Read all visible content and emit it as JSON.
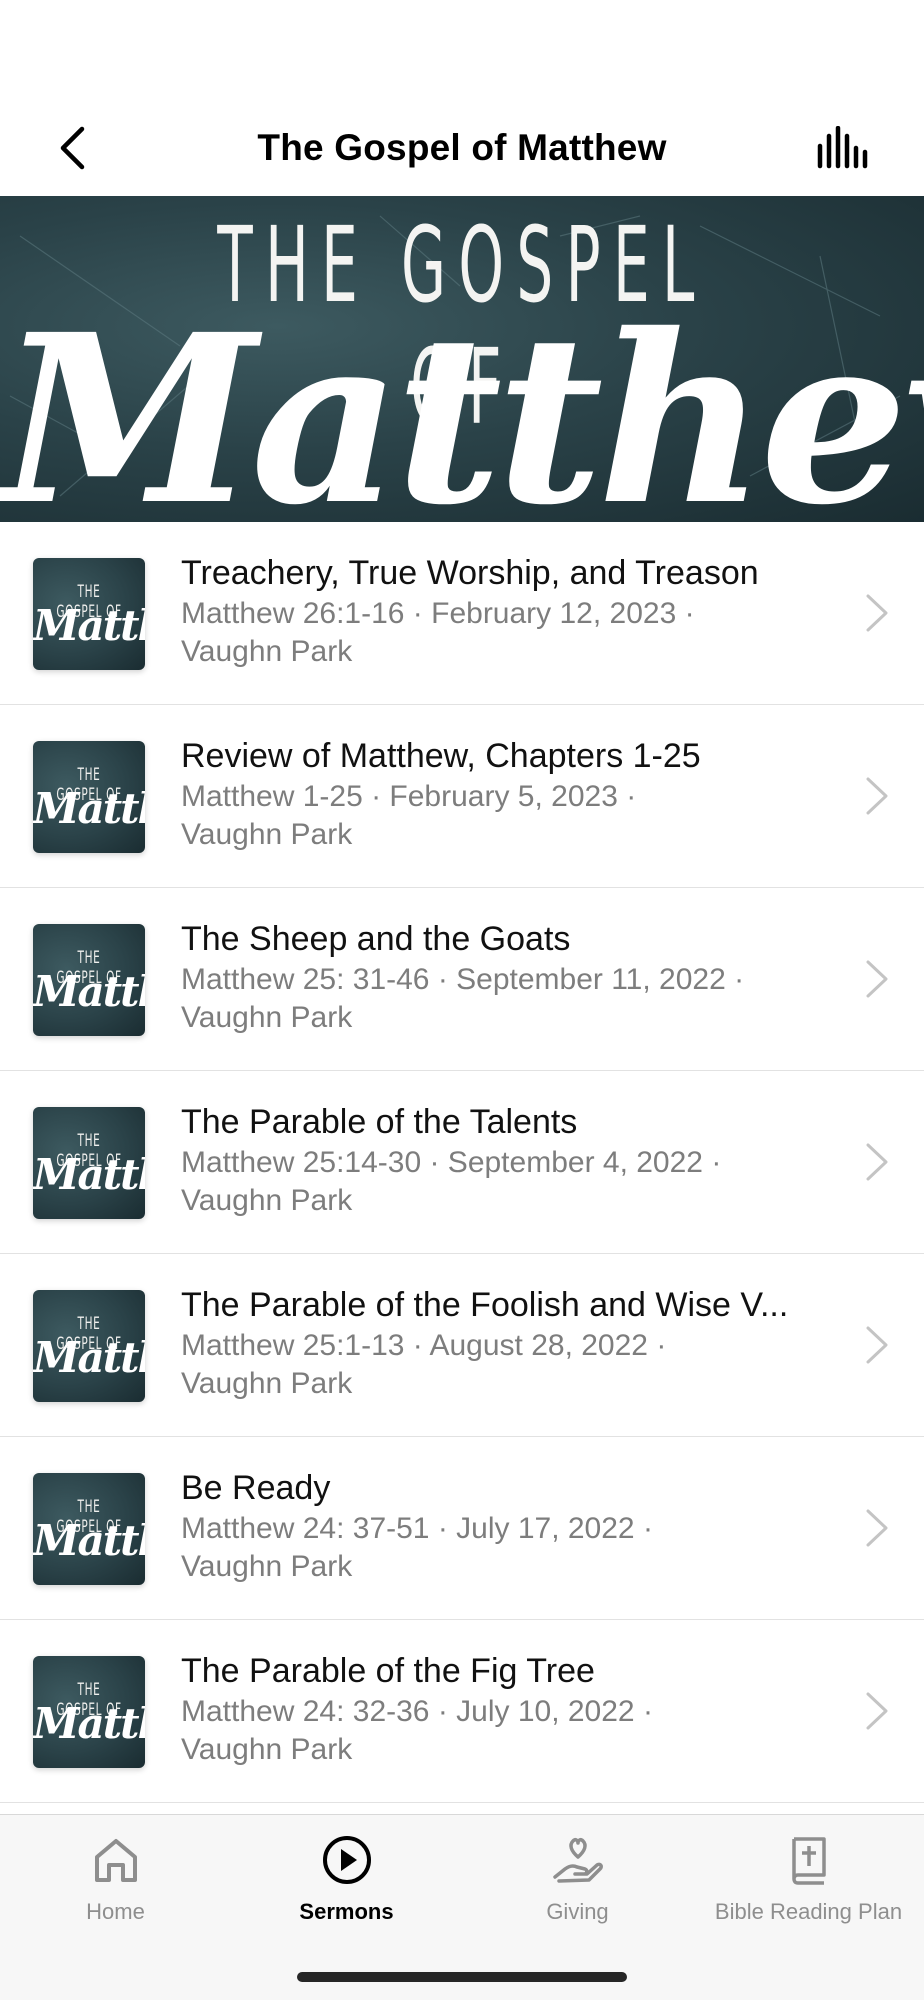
{
  "header": {
    "title": "The Gospel of Matthew",
    "back_icon": "chevron-left-icon",
    "audio_icon": "audio-levels-icon"
  },
  "banner": {
    "line1": "THE GOSPEL OF",
    "line2": "Matthew"
  },
  "thumbnail": {
    "line1": "THE GOSPEL OF",
    "line2": "Matthew"
  },
  "sermons": [
    {
      "title": "Treachery, True Worship, and Treason",
      "subtitle_line1": "Matthew 26:1-16 · February 12, 2023 ·",
      "subtitle_line2": "Vaughn Park"
    },
    {
      "title": "Review of Matthew, Chapters 1-25",
      "subtitle_line1": "Matthew 1-25 · February 5, 2023 ·",
      "subtitle_line2": "Vaughn Park"
    },
    {
      "title": "The Sheep and the Goats",
      "subtitle_line1": "Matthew 25: 31-46 · September 11, 2022 ·",
      "subtitle_line2": "Vaughn Park"
    },
    {
      "title": "The Parable of the Talents",
      "subtitle_line1": "Matthew 25:14-30 · September 4, 2022 ·",
      "subtitle_line2": "Vaughn Park"
    },
    {
      "title": "The Parable of the Foolish and Wise V...",
      "subtitle_line1": "Matthew 25:1-13 · August 28, 2022 ·",
      "subtitle_line2": "Vaughn Park"
    },
    {
      "title": "Be Ready",
      "subtitle_line1": "Matthew 24: 37-51 · July 17, 2022 ·",
      "subtitle_line2": "Vaughn Park"
    },
    {
      "title": "The Parable of the Fig Tree",
      "subtitle_line1": "Matthew 24: 32-36 · July 10, 2022 ·",
      "subtitle_line2": "Vaughn Park"
    }
  ],
  "tabs": [
    {
      "label": "Home",
      "icon": "home-icon",
      "active": false
    },
    {
      "label": "Sermons",
      "icon": "play-circle-icon",
      "active": true
    },
    {
      "label": "Giving",
      "icon": "heart-hand-icon",
      "active": false
    },
    {
      "label": "Bible Reading Plan",
      "icon": "bible-cross-icon",
      "active": false
    }
  ],
  "colors": {
    "banner_bg": "#2a4248",
    "active_tab": "#000000",
    "inactive_tab": "#8e8e8e",
    "subtitle": "#7d7d7d"
  }
}
